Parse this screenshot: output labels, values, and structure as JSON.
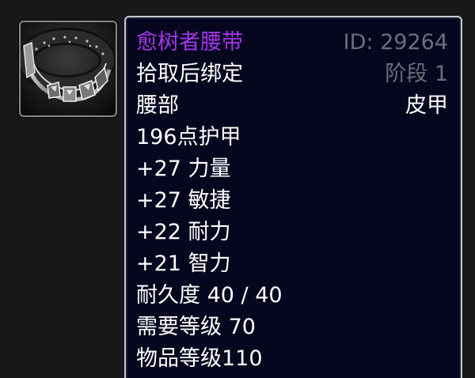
{
  "item": {
    "icon": "belt-icon",
    "name": "愈树者腰带",
    "name_color": "#a335ee",
    "id_label": "ID: 29264",
    "binding": "拾取后绑定",
    "tier": "阶段 1",
    "slot": "腰部",
    "armor_type": "皮甲",
    "armor": "196点护甲",
    "stats": [
      "+27 力量",
      "+27 敏捷",
      "+22 耐力",
      "+21 智力"
    ],
    "durability": "耐久度 40 / 40",
    "required_level": "需要等级 70",
    "item_level": "物品等级110"
  },
  "colors": {
    "tooltip_background": "#06071e",
    "tooltip_border": "#c9c9cf",
    "text": "#ffffff",
    "muted_text": "#6c6e7a"
  }
}
